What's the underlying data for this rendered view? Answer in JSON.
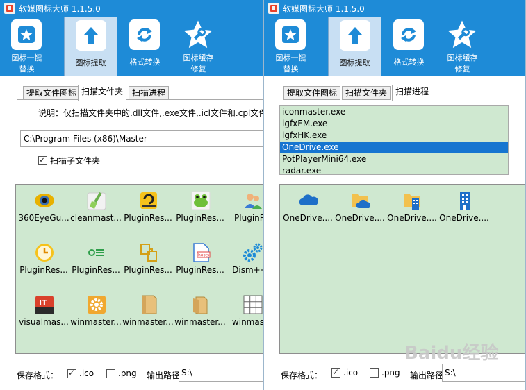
{
  "app": {
    "title": "软媒图标大师 1.1.5.0",
    "toolbar": [
      {
        "line1": "图标一键",
        "line2": "替换",
        "icon": "star-icon"
      },
      {
        "line1": "图标提取",
        "line2": "",
        "icon": "arrow-up-icon"
      },
      {
        "line1": "格式转换",
        "line2": "",
        "icon": "refresh-icon"
      },
      {
        "line1": "图标缓存",
        "line2": "修复",
        "icon": "wrench-star-icon"
      }
    ],
    "tabs": [
      "提取文件图标",
      "扫描文件夹",
      "扫描进程"
    ]
  },
  "left": {
    "active_tab": "扫描文件夹",
    "hint": "说明：仅扫描文件夹中的.dll文件,.exe文件,.icl文件和.cpl文件",
    "path_value": "C:\\Program Files (x86)\\Master",
    "subfolder_label": "扫描子文件夹",
    "icons": [
      {
        "label": "360EyeGu...",
        "icon": "eye-icon"
      },
      {
        "label": "cleanmast...",
        "icon": "broom-icon"
      },
      {
        "label": "PluginRes...",
        "icon": "yellow-disk-icon"
      },
      {
        "label": "PluginRes...",
        "icon": "frog-icon"
      },
      {
        "label": "PluginRe",
        "icon": "users-icon"
      },
      {
        "label": "PluginRes...",
        "icon": "clock-icon"
      },
      {
        "label": "PluginRes...",
        "icon": "list-icon"
      },
      {
        "label": "PluginRes...",
        "icon": "files-icon"
      },
      {
        "label": "PluginRes...",
        "icon": "hosts-file-icon"
      },
      {
        "label": "Dism++x",
        "icon": "gears-icon"
      },
      {
        "label": "visualmas...",
        "icon": "it-icon"
      },
      {
        "label": "winmaster...",
        "icon": "gear-tile-icon"
      },
      {
        "label": "winmaster...",
        "icon": "file-icon"
      },
      {
        "label": "winmaster...",
        "icon": "folder-doc-icon"
      },
      {
        "label": "winmaste",
        "icon": "grid-icon"
      }
    ]
  },
  "right": {
    "active_tab": "扫描进程",
    "processes": [
      "iconmaster.exe",
      "igfxEM.exe",
      "igfxHK.exe",
      "OneDrive.exe",
      "PotPlayerMini64.exe",
      "radar.exe"
    ],
    "selected_process": "OneDrive.exe",
    "icons": [
      {
        "label": "OneDrive....",
        "icon": "cloud-icon"
      },
      {
        "label": "OneDrive....",
        "icon": "folder-cloud-icon"
      },
      {
        "label": "OneDrive....",
        "icon": "folder-building-icon"
      },
      {
        "label": "OneDrive....",
        "icon": "building-icon"
      }
    ]
  },
  "footer": {
    "save_label": "保存格式：",
    "ico_label": ".ico",
    "png_label": ".png",
    "output_label": "输出路径",
    "output_value": "S:\\"
  },
  "watermark": "Baidu经验",
  "colors": {
    "accent": "#1e8bd7",
    "panel_green": "#cfe8d0",
    "selection": "#1675d0"
  }
}
